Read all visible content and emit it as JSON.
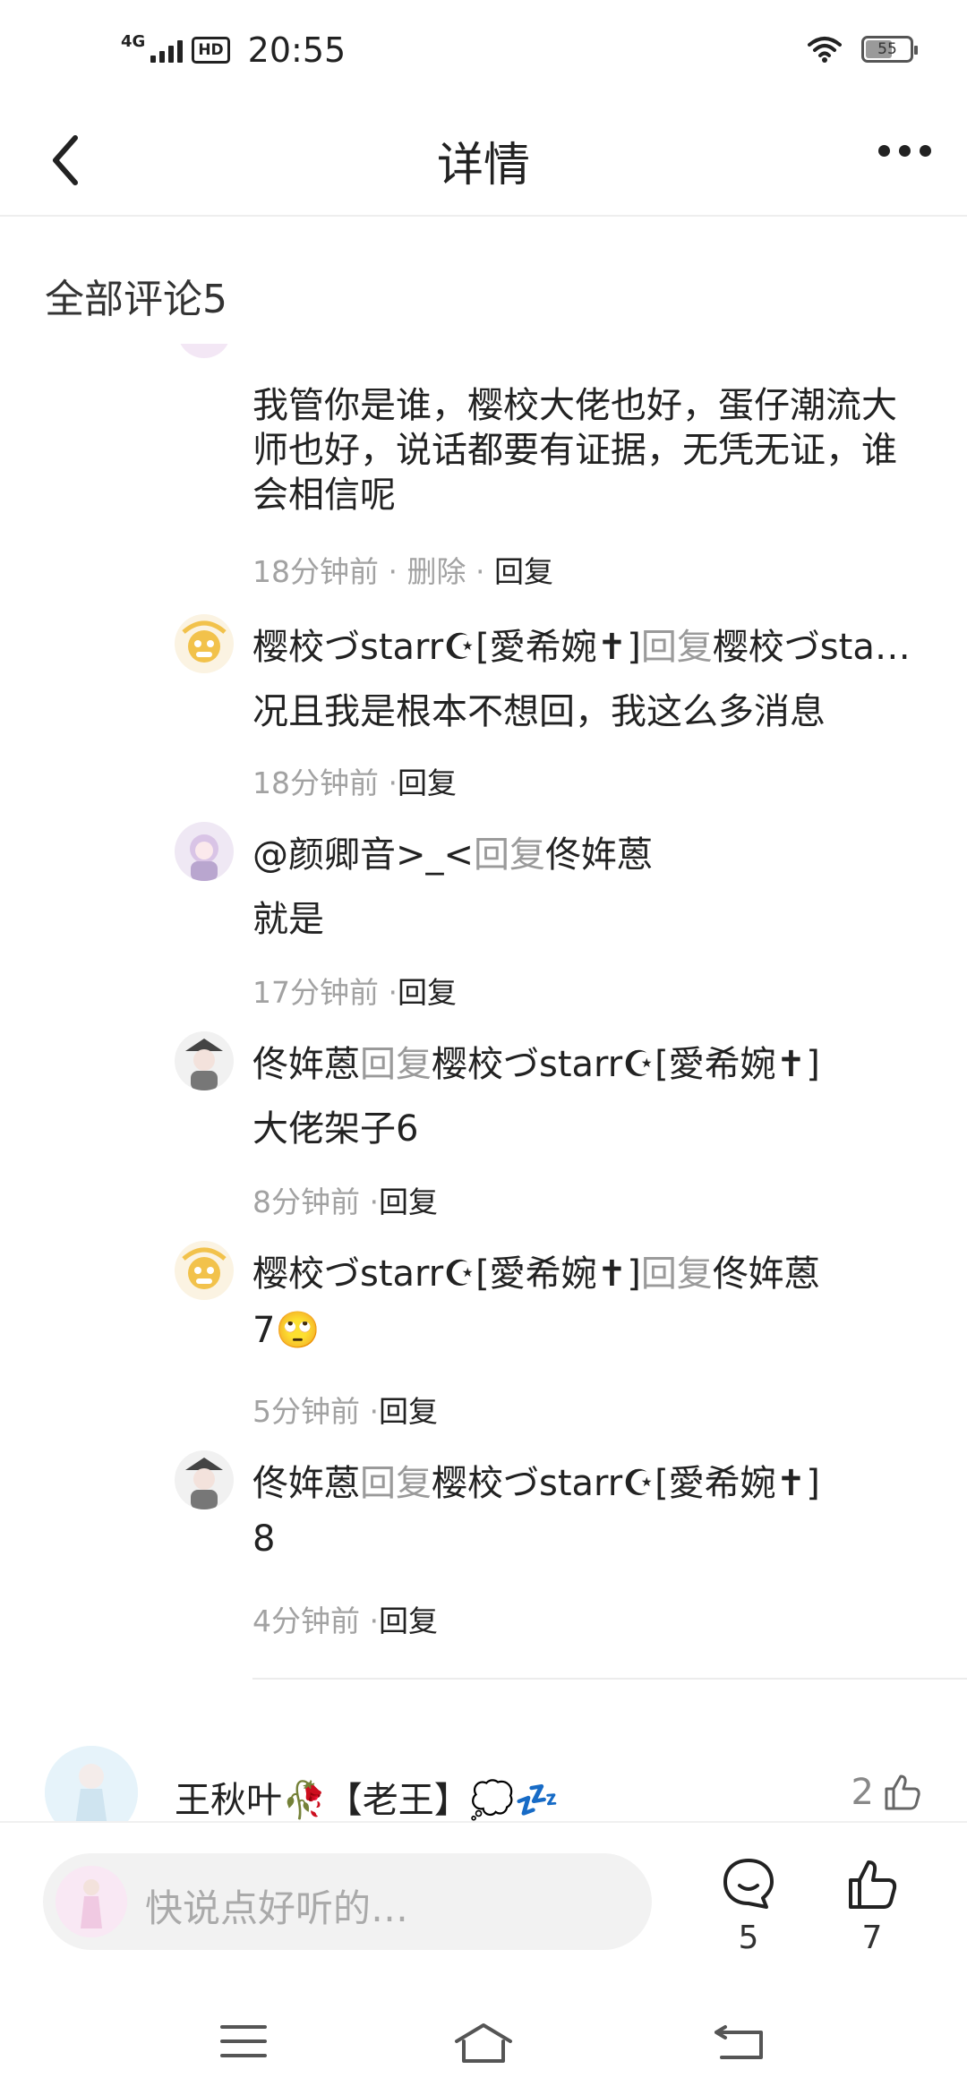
{
  "status_bar": {
    "network": "4G",
    "hd": "HD",
    "time": "20:55",
    "battery": "55",
    "battery_level": 0.55
  },
  "nav": {
    "title": "详情"
  },
  "section": {
    "title": "全部评论5"
  },
  "first_reply": {
    "text": "我管你是谁，樱校大佬也好，蛋仔潮流大师也好，说话都要有证据，无凭无证，谁会相信呢",
    "time": "18分钟前",
    "sep1": " · ",
    "delete": "删除",
    "sep2": " · ",
    "reply": "回复"
  },
  "replies": [
    {
      "author": "樱校づstarr☪[愛希婉✝]",
      "reply_word": "回复",
      "target": "樱校づsta…",
      "text": "况且我是根本不想回，我这么多消息",
      "time": "18分钟前",
      "sep": " ·",
      "reply": "回复"
    },
    {
      "author": "@颜卿音>_<",
      "reply_word": "回复",
      "target": "佟姩蒽",
      "text": "就是",
      "time": "17分钟前",
      "sep": " ·",
      "reply": "回复"
    },
    {
      "author": "佟姩蒽",
      "reply_word": "回复",
      "target": "樱校づstarr☪[愛希婉✝]",
      "text": "大佬架子6",
      "time": "8分钟前",
      "sep": " ·",
      "reply": "回复"
    },
    {
      "author": "樱校づstarr☪[愛希婉✝]",
      "reply_word": "回复",
      "target": "佟姩蒽",
      "text": "7🙄",
      "time": "5分钟前",
      "sep": " ·",
      "reply": "回复"
    },
    {
      "author": "佟姩蒽",
      "reply_word": "回复",
      "target": "樱校づstarr☪[愛希婉✝]",
      "text": "8",
      "time": "4分钟前",
      "sep": " ·",
      "reply": "回复"
    }
  ],
  "next_comment": {
    "name": "王秋叶🥀【老王】💭💤",
    "likes": "2"
  },
  "bottom_bar": {
    "placeholder": "快说点好听的…",
    "comment_count": "5",
    "like_count": "7"
  },
  "colors": {
    "text": "#222222",
    "muted": "#9a9a9a",
    "input_bg": "#f2f2f2",
    "divider": "#ececec"
  }
}
